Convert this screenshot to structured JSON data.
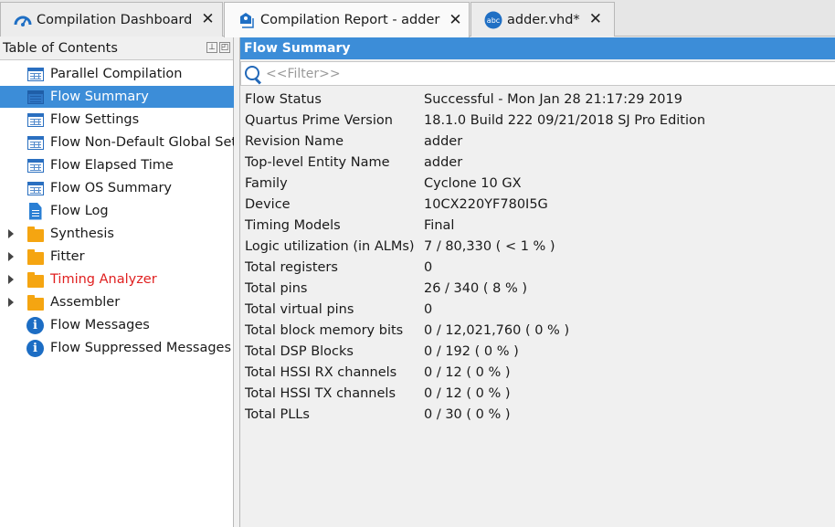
{
  "tabs": [
    {
      "label": "Compilation Dashboard",
      "icon": "dashboard-icon",
      "active": false
    },
    {
      "label": "Compilation Report - adder",
      "icon": "report-icon",
      "active": true
    },
    {
      "label": "adder.vhd*",
      "icon": "abc-file-icon",
      "active": false
    }
  ],
  "toc": {
    "title": "Table of Contents",
    "items": [
      {
        "label": "Parallel Compilation",
        "icon": "table-icon"
      },
      {
        "label": "Flow Summary",
        "icon": "table-icon",
        "selected": true
      },
      {
        "label": "Flow Settings",
        "icon": "table-icon"
      },
      {
        "label": "Flow Non-Default Global Settings",
        "icon": "table-icon"
      },
      {
        "label": "Flow Elapsed Time",
        "icon": "table-icon"
      },
      {
        "label": "Flow OS Summary",
        "icon": "table-icon"
      },
      {
        "label": "Flow Log",
        "icon": "document-icon"
      },
      {
        "label": "Synthesis",
        "icon": "folder-icon",
        "expandable": true
      },
      {
        "label": "Fitter",
        "icon": "folder-icon",
        "expandable": true
      },
      {
        "label": "Timing Analyzer",
        "icon": "folder-icon",
        "expandable": true,
        "color": "#e02020"
      },
      {
        "label": "Assembler",
        "icon": "folder-icon",
        "expandable": true
      },
      {
        "label": "Flow Messages",
        "icon": "info-icon"
      },
      {
        "label": "Flow Suppressed Messages",
        "icon": "info-icon"
      }
    ]
  },
  "main": {
    "title": "Flow Summary",
    "filter_placeholder": "<<Filter>>",
    "rows": [
      {
        "key": "Flow Status",
        "value": "Successful - Mon Jan 28 21:17:29 2019"
      },
      {
        "key": "Quartus Prime Version",
        "value": "18.1.0 Build 222 09/21/2018 SJ Pro Edition"
      },
      {
        "key": "Revision Name",
        "value": "adder"
      },
      {
        "key": "Top-level Entity Name",
        "value": "adder"
      },
      {
        "key": "Family",
        "value": "Cyclone 10 GX"
      },
      {
        "key": "Device",
        "value": "10CX220YF780I5G"
      },
      {
        "key": "Timing Models",
        "value": "Final"
      },
      {
        "key": "Logic utilization (in ALMs)",
        "value": "7 / 80,330 ( < 1 % )"
      },
      {
        "key": "Total registers",
        "value": "0"
      },
      {
        "key": "Total pins",
        "value": "26 / 340 ( 8 % )"
      },
      {
        "key": "Total virtual pins",
        "value": "0"
      },
      {
        "key": "Total block memory bits",
        "value": "0 / 12,021,760 ( 0 % )"
      },
      {
        "key": "Total DSP Blocks",
        "value": "0 / 192 ( 0 % )"
      },
      {
        "key": "Total HSSI RX channels",
        "value": "0 / 12 ( 0 % )"
      },
      {
        "key": "Total HSSI TX channels",
        "value": "0 / 12 ( 0 % )"
      },
      {
        "key": "Total PLLs",
        "value": "0 / 30 ( 0 % )"
      }
    ]
  },
  "colors": {
    "accent": "#3c8dd8",
    "folder": "#f5a511",
    "warning_text": "#e02020"
  }
}
